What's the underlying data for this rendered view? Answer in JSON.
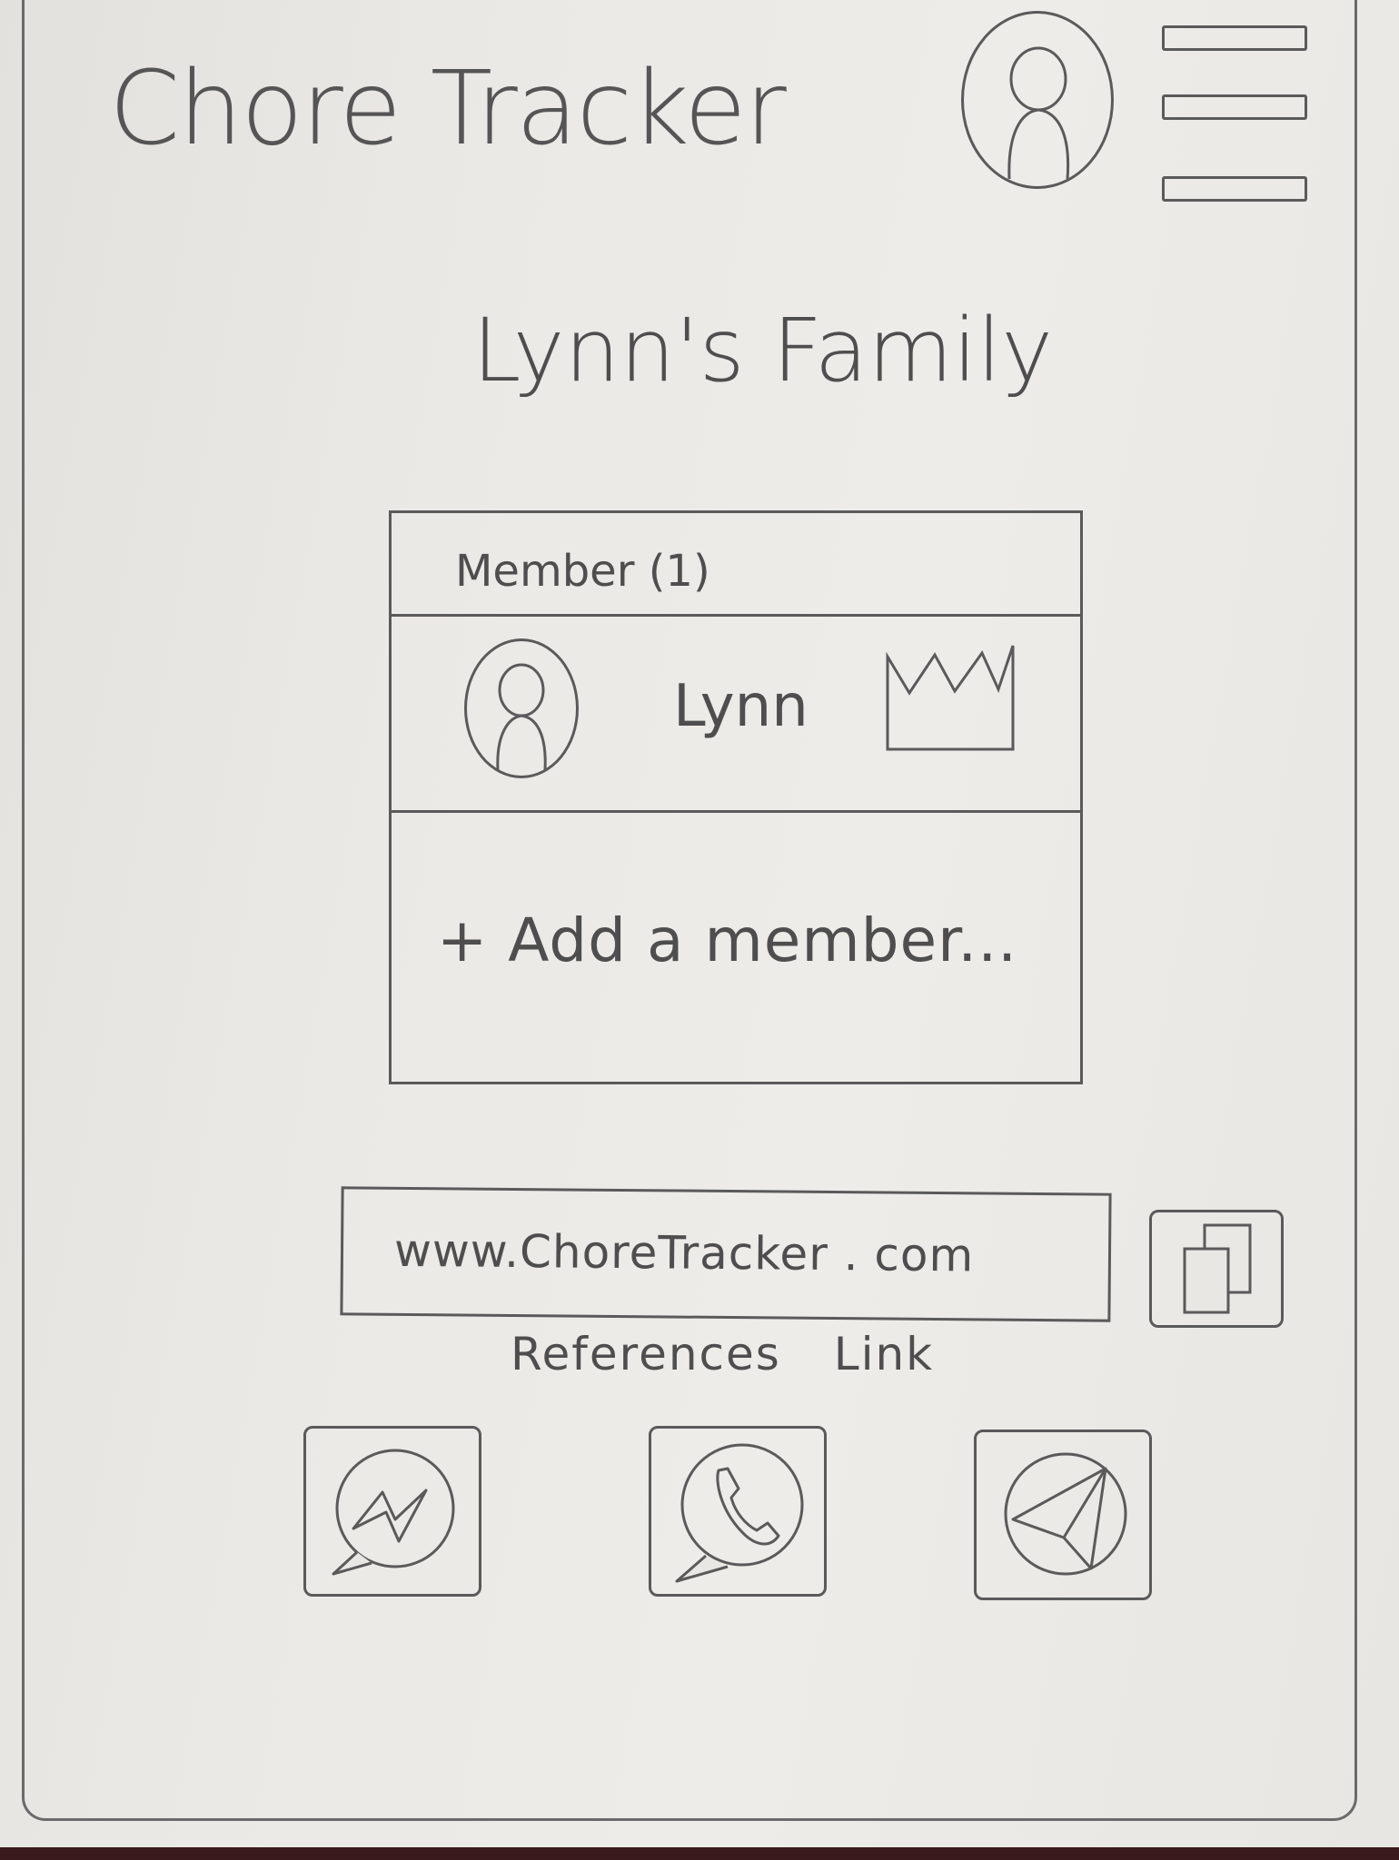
{
  "header": {
    "app_title": "Chore Tracker",
    "avatar_icon": "user-avatar-icon",
    "menu_icon": "hamburger-menu-icon"
  },
  "family": {
    "title": "Lynn's Family"
  },
  "members": {
    "header": "Member (1)",
    "items": [
      {
        "name": "Lynn",
        "avatar_icon": "user-avatar-icon",
        "badge_icon": "crown-icon"
      }
    ],
    "add_label": "+ Add a member..."
  },
  "share": {
    "link_value": "www.ChoreTracker . com",
    "copy_icon": "copy-icon",
    "label": "References Link",
    "buttons": [
      {
        "icon": "messenger-icon"
      },
      {
        "icon": "whatsapp-icon"
      },
      {
        "icon": "telegram-icon"
      }
    ]
  }
}
